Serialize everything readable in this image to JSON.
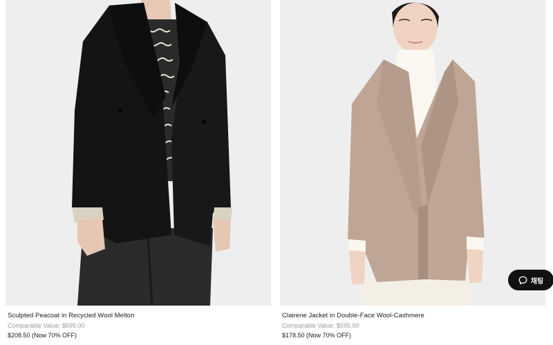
{
  "products": [
    {
      "name": "Sculpted Peacoat in Recycled Wool Melton",
      "comparable": "Comparable Value: $695.00",
      "price": "$208.50 (Now 70% OFF)",
      "image": "black-peacoat-photo"
    },
    {
      "name": "Clairene Jacket in Double-Face Wool-Cashmere",
      "comparable": "Comparable Value: $595.00",
      "price": "$178.50 (Now 70% OFF)",
      "image": "camel-jacket-photo"
    }
  ],
  "chat": {
    "label": "채팅",
    "icon": "chat-bubble-icon"
  },
  "colors": {
    "photo_bg": "#eeeeee",
    "coat_black": "#141414",
    "jacket_camel": "#bfa595",
    "chat_bg": "#111111"
  }
}
